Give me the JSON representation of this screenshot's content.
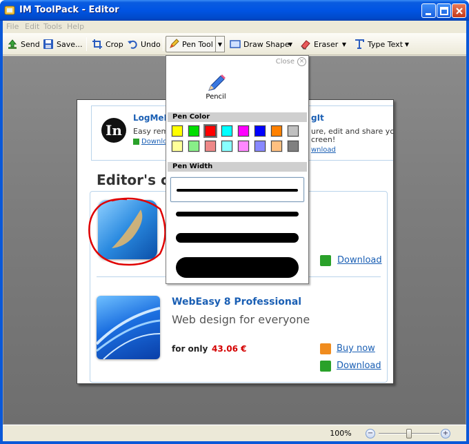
{
  "window": {
    "title": "IM ToolPack - Editor",
    "buttons": [
      "minimize-icon",
      "maximize-icon",
      "close-icon"
    ]
  },
  "menu": [
    "File",
    "Edit",
    "Tools",
    "Help"
  ],
  "toolbar": {
    "send": "Send",
    "save": "Save...",
    "crop": "Crop",
    "undo": "Undo",
    "pen_tool": "Pen Tool",
    "draw_shape": "Draw Shape",
    "eraser": "Eraser",
    "type_text": "Type Text",
    "arrow_glyph": "▼"
  },
  "pen_panel": {
    "close_label": "Close",
    "close_glyph": "×",
    "tool_label": "Pencil",
    "pen_color_header": "Pen Color",
    "pen_width_header": "Pen Width",
    "colors_row1": [
      "#ffff00",
      "#00dd00",
      "#ff0000",
      "#00ffff",
      "#ff00ff",
      "#0000ff",
      "#ff8000",
      "#c0c0c0"
    ],
    "colors_row2": [
      "#ffff99",
      "#88ee88",
      "#ee8888",
      "#88ffff",
      "#ff88ff",
      "#8888ff",
      "#ffc080",
      "#808080"
    ],
    "selected_color": "#ff0000",
    "widths": [
      1,
      2,
      3,
      4
    ],
    "selected_width": 1
  },
  "document": {
    "lm_title": "LogMeIn",
    "lm_desc": "Easy rem",
    "lm_download": "Download",
    "lm_right_title": "gIt",
    "lm_right_desc1": "ure, edit and share yo",
    "lm_right_desc2": "creen!",
    "lm_right_download": "wnload",
    "editors_heading": "Editor's ch",
    "download_1": "Download",
    "we_title": "WebEasy 8 Professional",
    "we_subtitle": "Web design for everyone",
    "we_for_only": "for only",
    "we_price": "43.06 €",
    "buy_now": "Buy now",
    "download_2": "Download",
    "logo_text": "In"
  },
  "status": {
    "zoom": "100%",
    "zoom_minus": "−",
    "zoom_plus": "+"
  }
}
